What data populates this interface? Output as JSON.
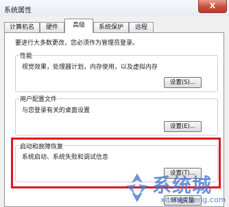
{
  "window": {
    "title": "系统属性",
    "close_label": "X"
  },
  "tabs": [
    {
      "label": "计算机名"
    },
    {
      "label": "硬件"
    },
    {
      "label": "高级"
    },
    {
      "label": "系统保护"
    },
    {
      "label": "远程"
    }
  ],
  "notice": "要进行大多数更改，您必须作为管理员登录。",
  "performance": {
    "title": "性能",
    "description": "视觉效果，处理器计划，内存使用，以及虚拟内存",
    "button": "设置(S)..."
  },
  "user_profiles": {
    "title": "用户配置文件",
    "description": "与您登录有关的桌面设置",
    "button": "设置(E)..."
  },
  "startup_recovery": {
    "title": "启动和故障恢复",
    "description": "系统启动、系统失败和调试信息",
    "button": "设置(T)..."
  },
  "env_button": "环境变量",
  "watermark": {
    "text": "系统城",
    "url": "xitongcheng.com"
  },
  "colors": {
    "highlight": "#e3141a",
    "tab_border": "#8d95a0",
    "watermark": "#4678d2"
  }
}
